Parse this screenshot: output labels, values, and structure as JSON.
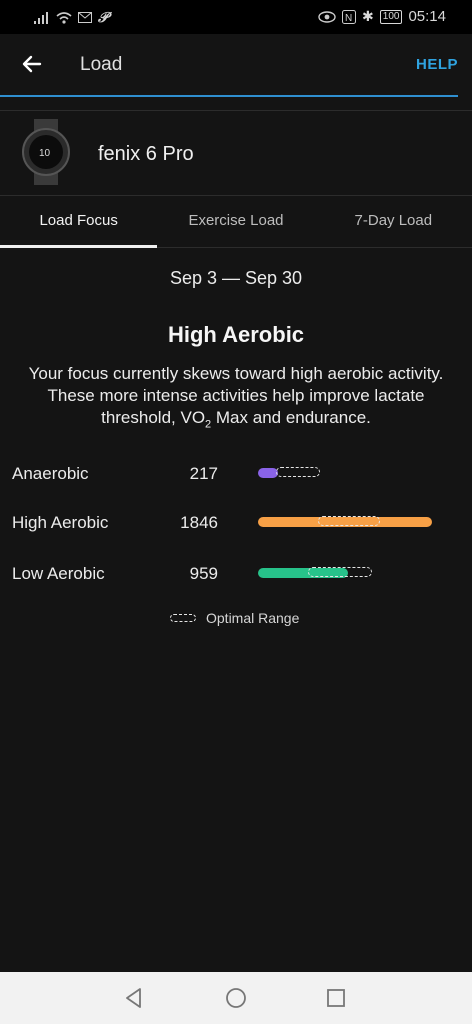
{
  "status_bar": {
    "time": "05:14",
    "battery": "100"
  },
  "app_bar": {
    "title": "Load",
    "help_label": "HELP"
  },
  "device": {
    "name": "fenix 6 Pro",
    "watch_face_text": "10"
  },
  "tabs": [
    {
      "label": "Load Focus",
      "active": true
    },
    {
      "label": "Exercise Load",
      "active": false
    },
    {
      "label": "7-Day Load",
      "active": false
    }
  ],
  "date_range": "Sep 3 — Sep 30",
  "focus": {
    "title": "High Aerobic",
    "desc_part1": "Your focus currently skews toward high aerobic activity. These more intense activities help improve lactate threshold, VO",
    "desc_sub": "2",
    "desc_part2": " Max and endurance."
  },
  "load_rows": [
    {
      "label": "Anaerobic",
      "value": "217",
      "color": "#8a63e8"
    },
    {
      "label": "High Aerobic",
      "value": "1846",
      "color": "#f7a046"
    },
    {
      "label": "Low Aerobic",
      "value": "959",
      "color": "#27c28a"
    }
  ],
  "legend_label": "Optimal Range"
}
